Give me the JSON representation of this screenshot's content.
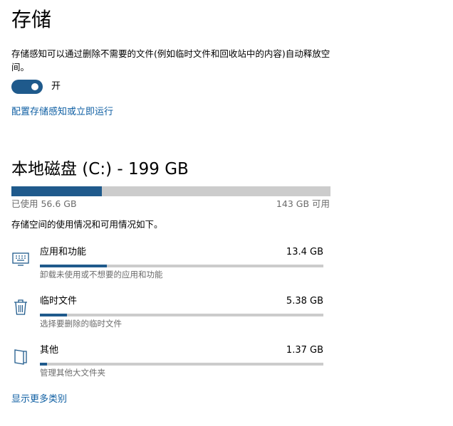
{
  "page": {
    "title": "存储"
  },
  "storage_sense": {
    "description": "存储感知可以通过删除不需要的文件(例如临时文件和回收站中的内容)自动释放空间。",
    "toggle_state_label": "开",
    "toggle_on": true,
    "configure_link": "配置存储感知或立即运行"
  },
  "drive": {
    "title": "本地磁盘 (C:) - 199 GB",
    "used_label": "已使用 56.6 GB",
    "free_label": "143 GB 可用",
    "used_fraction": 0.284,
    "info": "存储空间的使用情况和可用情况如下。"
  },
  "categories": [
    {
      "name": "应用和功能",
      "size": "13.4 GB",
      "desc": "卸载未使用或不想要的应用和功能",
      "fraction": 0.237,
      "icon": "monitor-icon"
    },
    {
      "name": "临时文件",
      "size": "5.38 GB",
      "desc": "选择要删除的临时文件",
      "fraction": 0.095,
      "icon": "trash-icon"
    },
    {
      "name": "其他",
      "size": "1.37 GB",
      "desc": "管理其他大文件夹",
      "fraction": 0.025,
      "icon": "book-icon"
    }
  ],
  "more_link": "显示更多类别",
  "colors": {
    "accent": "#1f5a8c",
    "track": "#cccccc",
    "link": "#0f5fa3"
  }
}
